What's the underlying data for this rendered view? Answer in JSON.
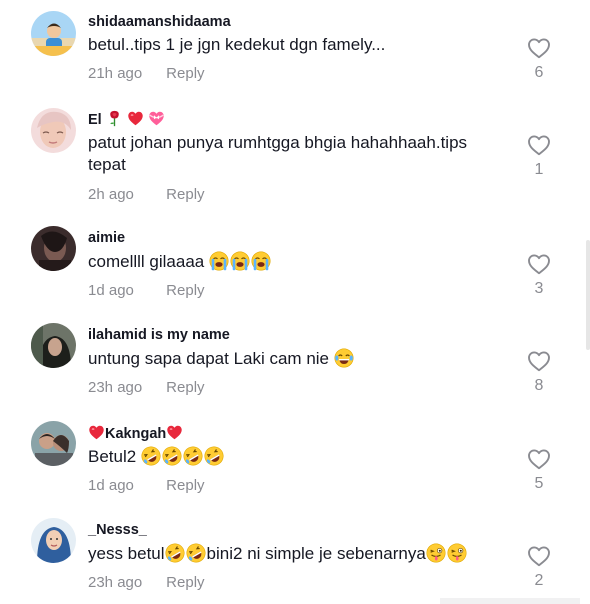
{
  "comments": [
    {
      "username": "shidaamanshidaama",
      "text": "betul..tips 1 je jgn kedekut dgn famely...",
      "time": "21h ago",
      "reply": "Reply",
      "likes": "6",
      "avatar_icon": "avatar-child-beach"
    },
    {
      "username": "El",
      "username_emojis": [
        "rose-emoji",
        "red-heart-emoji",
        "heart-with-ribbon-emoji"
      ],
      "text": "patut johan punya rumhtgga bhgia hahahhaah.tips tepat",
      "time": "2h ago",
      "reply": "Reply",
      "likes": "1",
      "avatar_icon": "avatar-woman-pink"
    },
    {
      "username": "aimie",
      "text": "comellll gilaaaa",
      "text_emojis": [
        "loudly-crying-face-emoji",
        "loudly-crying-face-emoji",
        "loudly-crying-face-emoji"
      ],
      "time": "1d ago",
      "reply": "Reply",
      "likes": "3",
      "avatar_icon": "avatar-dark-portrait"
    },
    {
      "username": "ilahamid is my name",
      "text": "untung sapa dapat Laki cam nie",
      "text_emojis": [
        "tears-of-joy-emoji"
      ],
      "time": "23h ago",
      "reply": "Reply",
      "likes": "8",
      "avatar_icon": "avatar-hijab-dark"
    },
    {
      "username": "Kakngah",
      "username_emojis": [
        "red-heart-emoji",
        "red-heart-emoji"
      ],
      "text": "Betul2",
      "text_emojis": [
        "rofl-emoji",
        "rofl-emoji",
        "rofl-emoji",
        "rofl-emoji"
      ],
      "time": "1d ago",
      "reply": "Reply",
      "likes": "5",
      "avatar_icon": "avatar-couple"
    },
    {
      "username": "_Nesss_",
      "text_parts": [
        "yess betul",
        "bini2 ni simple je sebenarnya"
      ],
      "text_emojis_1": [
        "rofl-emoji",
        "rofl-emoji"
      ],
      "text_emojis_2": [
        "winking-tongue-face-emoji",
        "winking-tongue-face-emoji"
      ],
      "time": "23h ago",
      "reply": "Reply",
      "likes": "2",
      "avatar_icon": "avatar-hijab-blue"
    }
  ],
  "colors": {
    "text": "#161823",
    "secondary": "#8a8b91",
    "background": "#ffffff",
    "heart_red": "#e8283c"
  }
}
